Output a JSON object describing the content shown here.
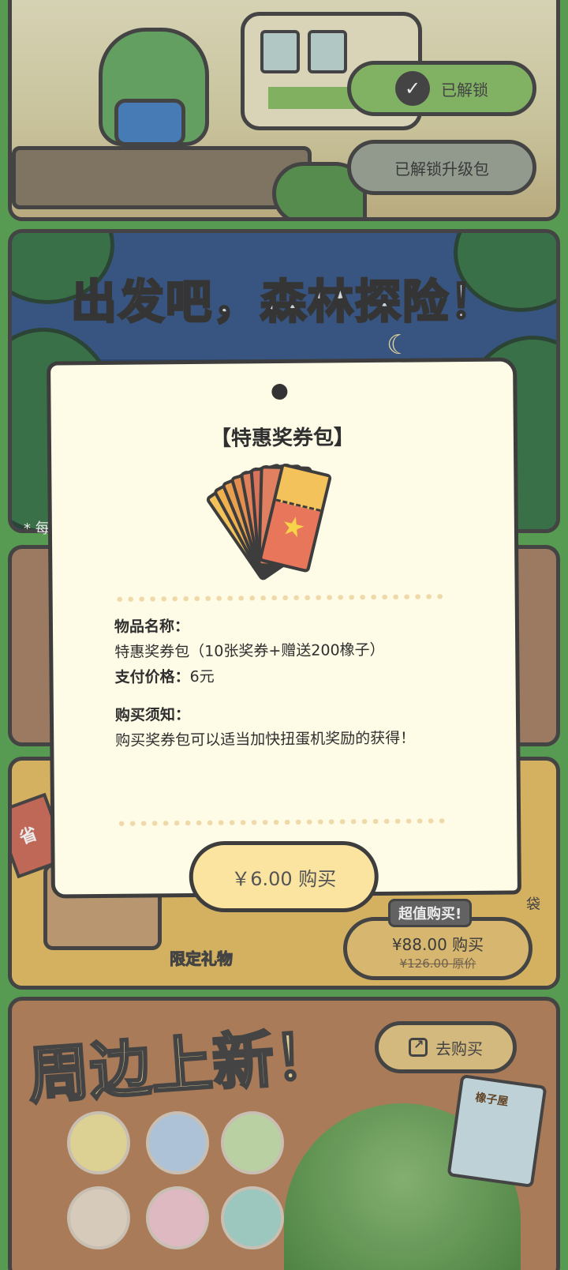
{
  "top_panel": {
    "unlocked_label": "已解锁",
    "unlocked_pack_label": "已解锁升级包"
  },
  "forest_banner": {
    "title": "出发吧，森林探险！"
  },
  "gacha_panel": {
    "note_fragment": "* 每"
  },
  "gift_panel": {
    "tag": "省",
    "limited_gift_label": "限定礼物",
    "bag_label": "袋",
    "super_buy_tag": "超值购买!",
    "super_buy_price": "¥88.00 购买",
    "super_buy_original": "¥126.00 原价"
  },
  "merch_panel": {
    "title": "周边上新！",
    "goto_buy_label": "去购买",
    "card_label": "橡子屋"
  },
  "modal": {
    "title": "【特惠奖券包】",
    "item_name_label": "物品名称：",
    "item_name_value": "特惠奖券包（10张奖券+赠送200橡子）",
    "price_label": "支付价格：",
    "price_value": "6元",
    "notice_label": "购买须知：",
    "notice_text": "购买奖券包可以适当加快扭蛋机奖励的获得！",
    "buy_button_label": "￥6.00 购买"
  },
  "colors": {
    "modal_bg": "#fefbe6",
    "buy_button_bg": "#fbe3a0",
    "page_bg": "#5fa85a",
    "unlocked_green": "#8cc06c"
  },
  "icons": [
    "check-icon",
    "external-link-icon",
    "ticket-icon",
    "moon-icon"
  ]
}
